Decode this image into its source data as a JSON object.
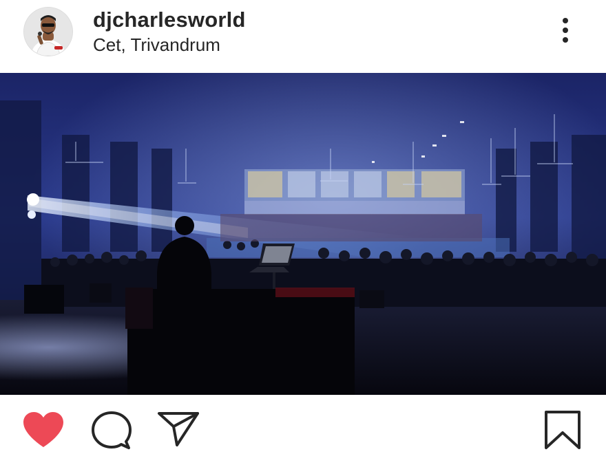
{
  "post": {
    "username": "djcharlesworld",
    "location": "Cet, Trivandrum"
  },
  "icons": {
    "avatar": "profile-photo",
    "more": "vertical-ellipsis-icon",
    "like": "heart-icon",
    "comment": "speech-bubble-icon",
    "share": "paper-plane-icon",
    "save": "bookmark-icon"
  },
  "state": {
    "liked": true
  },
  "colors": {
    "like_active": "#ed4956",
    "text": "#262626",
    "icon": "#262626"
  }
}
